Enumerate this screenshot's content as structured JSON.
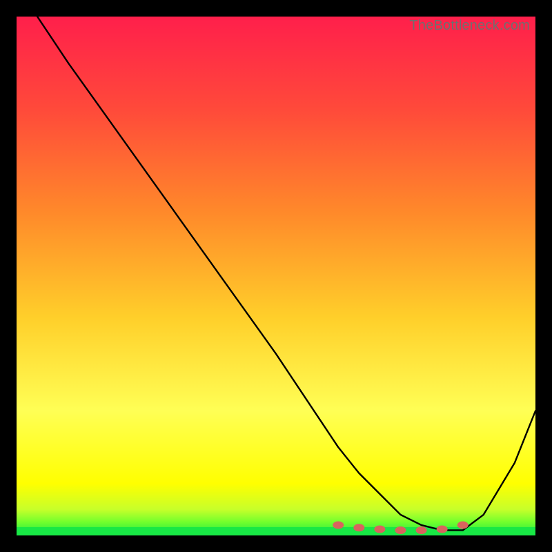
{
  "watermark": "TheBottleneck.com",
  "colors": {
    "bg_black": "#000000",
    "grad_top": "#ff1f4b",
    "grad_upper_mid": "#ff7a2a",
    "grad_mid": "#ffd92a",
    "grad_lower_mid": "#ffff66",
    "grad_deep_yellow": "#ffff00",
    "grad_green_light": "#9fff3a",
    "grad_green": "#2dff2d",
    "curve_stroke": "#000000",
    "green_band": "#19e84a",
    "marker_fill": "#d9635e",
    "marker_stroke": "#8b2d28",
    "watermark": "#6f6f6f"
  },
  "chart_data": {
    "type": "line",
    "title": "",
    "xlabel": "",
    "ylabel": "",
    "xlim": [
      0,
      100
    ],
    "ylim": [
      0,
      100
    ],
    "grid": false,
    "series": [
      {
        "name": "bottleneck-curve",
        "x": [
          4,
          10,
          20,
          30,
          40,
          50,
          58,
          62,
          66,
          70,
          74,
          78,
          82,
          86,
          90,
          96,
          100
        ],
        "y": [
          100,
          91,
          77,
          63,
          49,
          35,
          23,
          17,
          12,
          8,
          4,
          2,
          1,
          1,
          4,
          14,
          24
        ]
      }
    ],
    "markers": {
      "name": "highlight-points",
      "x": [
        62,
        66,
        70,
        74,
        78,
        82,
        86
      ],
      "y": [
        2,
        1.5,
        1.2,
        1.0,
        1.0,
        1.2,
        2
      ]
    },
    "annotations": []
  }
}
